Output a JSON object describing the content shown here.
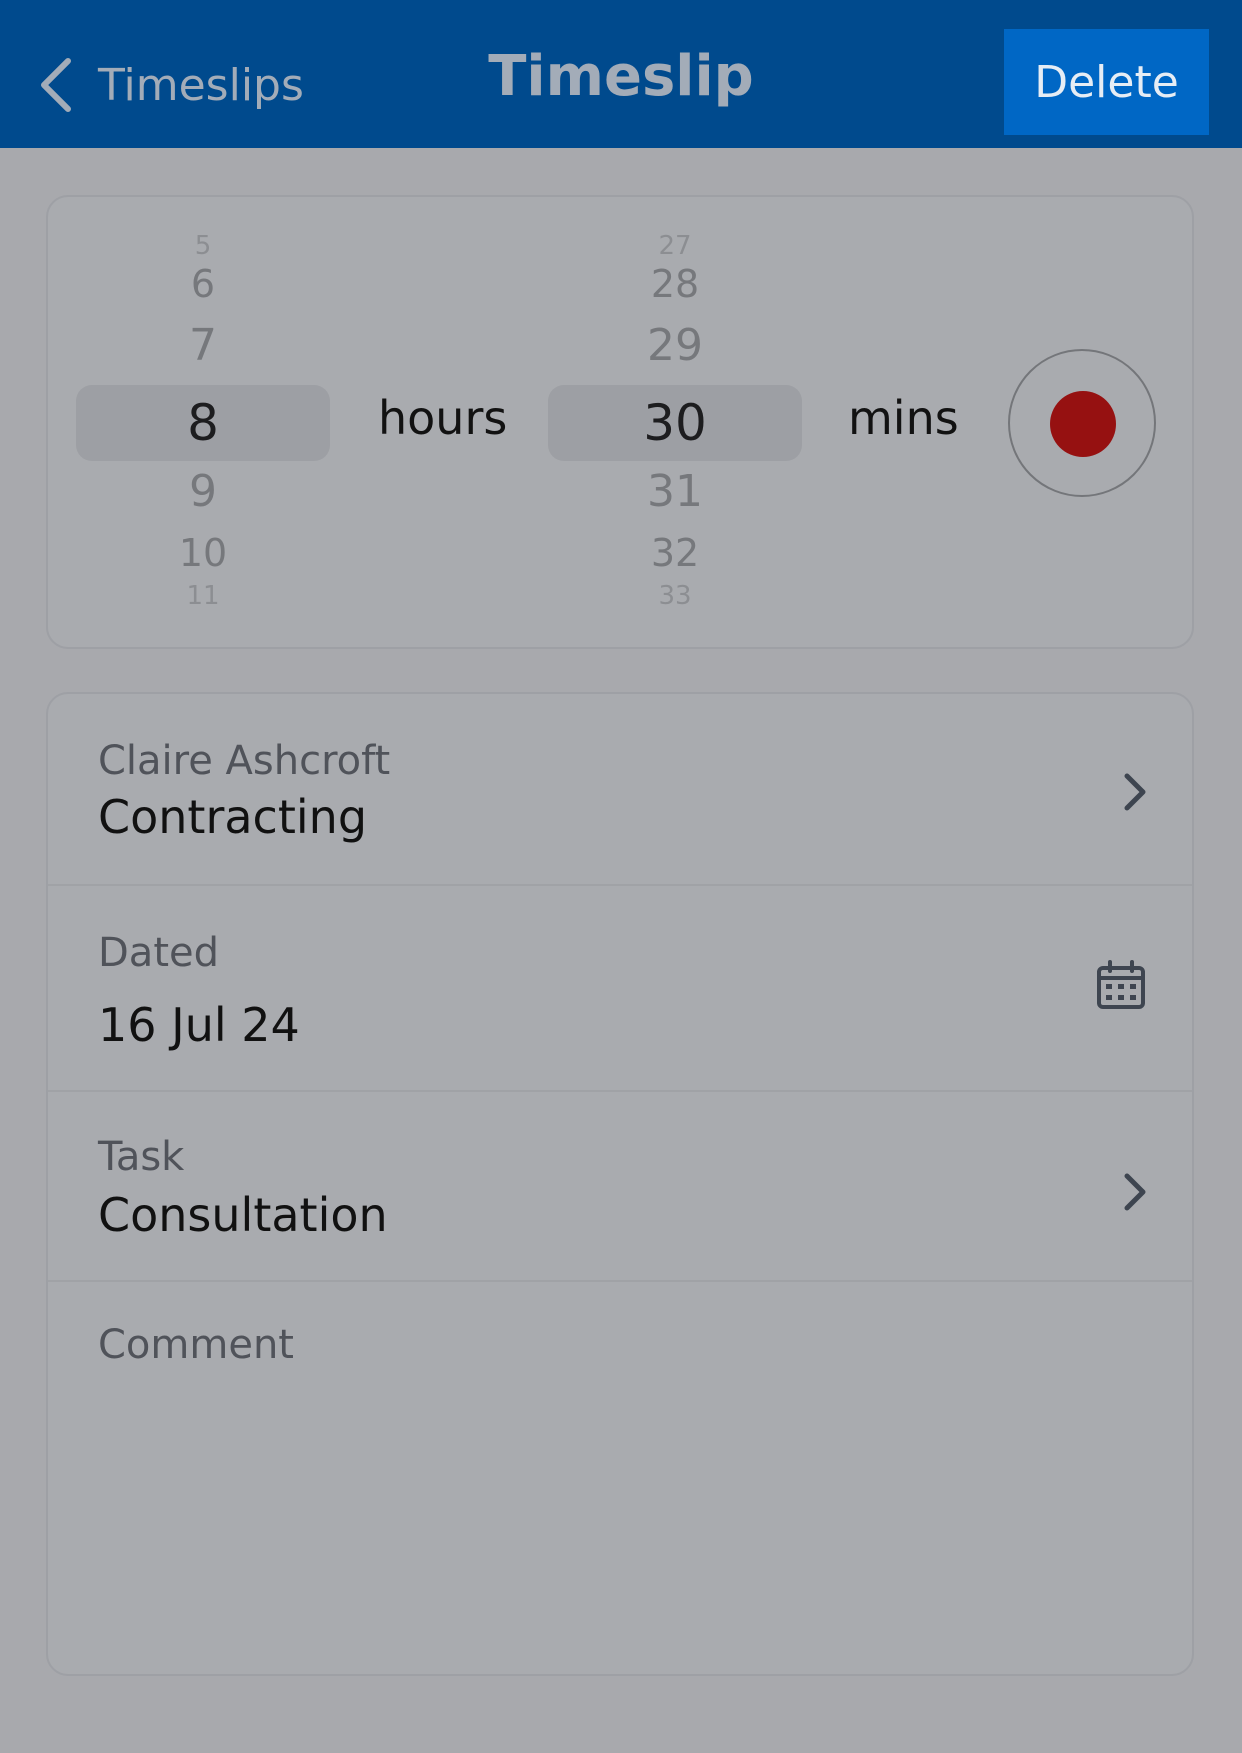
{
  "header": {
    "back_label": "Timeslips",
    "title": "Timeslip",
    "delete_label": "Delete",
    "colors": {
      "bar": "#004a8d",
      "delete": "#0067c5"
    }
  },
  "picker": {
    "hours": {
      "values_above": [
        "5",
        "6",
        "7"
      ],
      "selected": "8",
      "values_below": [
        "9",
        "10",
        "11"
      ],
      "unit_label": "hours"
    },
    "minutes": {
      "values_above": [
        "27",
        "28",
        "29"
      ],
      "selected": "30",
      "values_below": [
        "31",
        "32",
        "33"
      ],
      "unit_label": "mins"
    },
    "record_icon": "record-dot-icon",
    "record_color": "#961111"
  },
  "details": {
    "client": {
      "label": "Claire Ashcroft",
      "value": "Contracting",
      "icon": "chevron-right-icon"
    },
    "date": {
      "label": "Dated",
      "value": "16 Jul 24",
      "icon": "calendar-icon"
    },
    "task": {
      "label": "Task",
      "value": "Consultation",
      "icon": "chevron-right-icon"
    },
    "comment": {
      "label": "Comment",
      "value": ""
    }
  }
}
